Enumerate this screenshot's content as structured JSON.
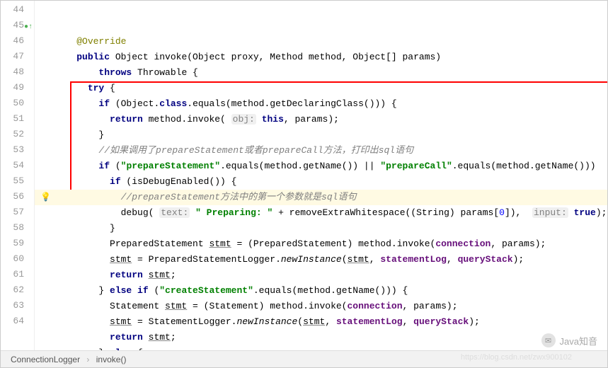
{
  "gutter": {
    "start": 44,
    "end": 64,
    "override_marker_line": 45,
    "bulb_line": 54,
    "caret_line": 54
  },
  "code": {
    "l44": {
      "ind": 2,
      "ann": "@Override"
    },
    "l45": {
      "ind": 2,
      "kw1": "public",
      "t1": " Object invoke(Object proxy, Method method, Object[] params)"
    },
    "l46": {
      "ind": 4,
      "kw1": "throws",
      "t1": " Throwable {"
    },
    "l47": {
      "ind": 3,
      "kw1": "try",
      "t1": " {"
    },
    "l48": {
      "ind": 4,
      "kw1": "if",
      "t1": " (Object.",
      "kw2": "class",
      "t2": ".equals(method.getDeclaringClass())) {"
    },
    "l49": {
      "ind": 5,
      "kw1": "return",
      "t1": " method.invoke( ",
      "hint1": "obj:",
      "t2": " ",
      "kw2": "this",
      "t3": ", params);"
    },
    "l50": {
      "ind": 4,
      "t1": "}"
    },
    "l51": {
      "ind": 4,
      "cm": "//如果调用了prepareStatement或者prepareCall方法，打印出sql语句"
    },
    "l52": {
      "ind": 4,
      "kw1": "if",
      "t1": " (",
      "s1": "\"prepareStatement\"",
      "t2": ".equals(method.getName()) || ",
      "s2": "\"prepareCall\"",
      "t3": ".equals(method.getName()))"
    },
    "l53": {
      "ind": 5,
      "kw1": "if",
      "t1": " (isDebugEnabled()) {"
    },
    "l54": {
      "ind": 6,
      "cm": "//prepareStatement方法中的第一个参数就是sql语句"
    },
    "l55": {
      "ind": 6,
      "t1": "debug( ",
      "hint1": "text:",
      "t2": " ",
      "s1": "\" Preparing: \"",
      "t3": " + removeExtraWhitespace((String) params[",
      "n1": "0",
      "t4": "]),  ",
      "hint2": "input:",
      "t5": " ",
      "kw1": "true",
      "t6": ");"
    },
    "l56": {
      "ind": 5,
      "t1": "}"
    },
    "l57": {
      "ind": 5,
      "t1": "PreparedStatement ",
      "u1": "stmt",
      "t2": " = (PreparedStatement) method.invoke(",
      "f1": "connection",
      "t3": ", params);"
    },
    "l58": {
      "ind": 5,
      "u1": "stmt",
      "t1": " = PreparedStatementLogger.",
      "m1": "newInstance",
      "t2": "(",
      "u2": "stmt",
      "t3": ", ",
      "f1": "statementLog",
      "t4": ", ",
      "f2": "queryStack",
      "t5": ");"
    },
    "l59": {
      "ind": 5,
      "kw1": "return",
      "t1": " ",
      "u1": "stmt",
      "t2": ";"
    },
    "l60": {
      "ind": 4,
      "t1": "} ",
      "kw1": "else if",
      "t2": " (",
      "s1": "\"createStatement\"",
      "t3": ".equals(method.getName())) {"
    },
    "l61": {
      "ind": 5,
      "t1": "Statement ",
      "u1": "stmt",
      "t2": " = (Statement) method.invoke(",
      "f1": "connection",
      "t3": ", params);"
    },
    "l62": {
      "ind": 5,
      "u1": "stmt",
      "t1": " = StatementLogger.",
      "m1": "newInstance",
      "t2": "(",
      "u2": "stmt",
      "t3": ", ",
      "f1": "statementLog",
      "t4": ", ",
      "f2": "queryStack",
      "t5": ");"
    },
    "l63": {
      "ind": 5,
      "kw1": "return",
      "t1": " ",
      "u1": "stmt",
      "t2": ";"
    },
    "l64": {
      "ind": 4,
      "t1": "} ",
      "kw1": "else",
      "t2": " {"
    }
  },
  "breadcrumb": {
    "class": "ConnectionLogger",
    "method": "invoke()"
  },
  "watermark": {
    "text": "Java知音",
    "url": "https://blog.csdn.net/zwx900102"
  }
}
